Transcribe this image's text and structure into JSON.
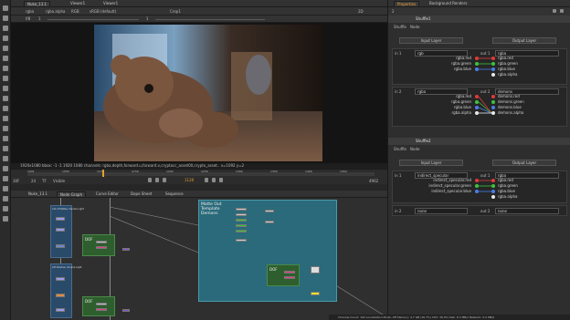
{
  "left_tools": {
    "icons": [
      "plus-icon",
      "pen-icon",
      "brush-icon",
      "clone-icon",
      "blur-icon",
      "dodge-icon",
      "transform-icon",
      "roto-icon",
      "shuffle-icon",
      "merge-icon",
      "color-icon",
      "filter-icon",
      "channel-icon",
      "keyer-icon",
      "time-icon",
      "3d-icon",
      "particles-icon",
      "deep-icon",
      "views-icon",
      "metadata-icon",
      "toolsets-icon",
      "other-icon"
    ]
  },
  "viewer": {
    "tabs": [
      "Nuke_13.1",
      "Viewer1",
      "Viewer1"
    ],
    "toolbar": {
      "layer": "rgba",
      "channel": "rgba.alpha",
      "colorspace": "RGB",
      "lut": "sRGB (default)",
      "gain_label": "f/8",
      "gain_value": "1",
      "zoom": "Crop1",
      "view_label": "2D"
    },
    "info_bar": "1920x1080 bbox: -1 -1 1920 1080 channels: rgba,depth,forward.u,forward.v,cryptocc_asset00,crypto_asset..  x=1092 y=2",
    "timeline": {
      "ticks": [
        "1001",
        "1050",
        "1100",
        "1150",
        "1200",
        "1250",
        "1300",
        "1350",
        "1400",
        "1450"
      ],
      "current_frame": "1120",
      "fps": "24",
      "end_frame": "4962",
      "in_label": "B",
      "out_label": "TF",
      "visible": "Visible",
      "size_label": "30F"
    }
  },
  "nodegraph": {
    "tabs": [
      "Nuke_13.1",
      "Node Graph",
      "Curve Editor",
      "Dope Sheet",
      "Sequence"
    ],
    "backdrop_label": "Matte Out\nTemplate\nDemons",
    "backdrop_small_a": "Cut of Mattes, Volume Light",
    "backdrop_small_b": "Lift Shadow, Volume Light",
    "dof_a": "DOF",
    "dof_b": "DOF",
    "dof_c": "DOF"
  },
  "properties": {
    "tabs": [
      "Properties",
      "Background Renders"
    ],
    "count": "2",
    "panels": [
      {
        "name": "Shuffle1",
        "tabs": [
          "Shuffle",
          "Node"
        ],
        "input_label": "Input Layer",
        "output_label": "Output Layer",
        "in1": {
          "label": "in 1",
          "layer": "rgb",
          "channels": [
            "rgba.red",
            "rgba.green",
            "rgba.blue"
          ]
        },
        "out1": {
          "label": "out 1",
          "layer": "rgba",
          "channels": [
            "rgba.red",
            "rgba.green",
            "rgba.blue",
            "rgba.alpha"
          ]
        },
        "in2": {
          "label": "in 2",
          "layer": "rgba",
          "channels": [
            "rgba.red",
            "rgba.green",
            "rgba.blue",
            "rgba.alpha"
          ]
        },
        "out2": {
          "label": "out 2",
          "layer": "demons",
          "channels": [
            "demons.red",
            "demons.green",
            "demons.blue",
            "demons.alpha"
          ]
        }
      },
      {
        "name": "Shuffle2",
        "tabs": [
          "Shuffle",
          "Node"
        ],
        "input_label": "Input Layer",
        "output_label": "Output Layer",
        "in1": {
          "label": "in 1",
          "layer": "indirect_specular",
          "channels": [
            "indirect_specular.red",
            "indirect_specular.green",
            "indirect_specular.blue"
          ]
        },
        "out1": {
          "label": "out 1",
          "layer": "rgba",
          "channels": [
            "rgba.red",
            "rgba.green",
            "rgba.blue",
            "rgba.alpha"
          ]
        },
        "in2": {
          "label": "in 2",
          "layer": "none"
        },
        "out2": {
          "label": "out 2",
          "layer": "none"
        }
      }
    ]
  },
  "status": "Channel Count: 100 Localization Mode: Off Memory: 4.7 GB (16.7%) CPU: 36.0% Disk: 8.3 MB/s Network: 0.0 MB/s",
  "colors": {
    "red": "#e03a3a",
    "green": "#3cc43c",
    "blue": "#4a7ee8",
    "alpha": "#e8e8e8",
    "backdrop": "#2a6a7a",
    "dof": "#2e5e2e",
    "orange": "#e8a030"
  }
}
